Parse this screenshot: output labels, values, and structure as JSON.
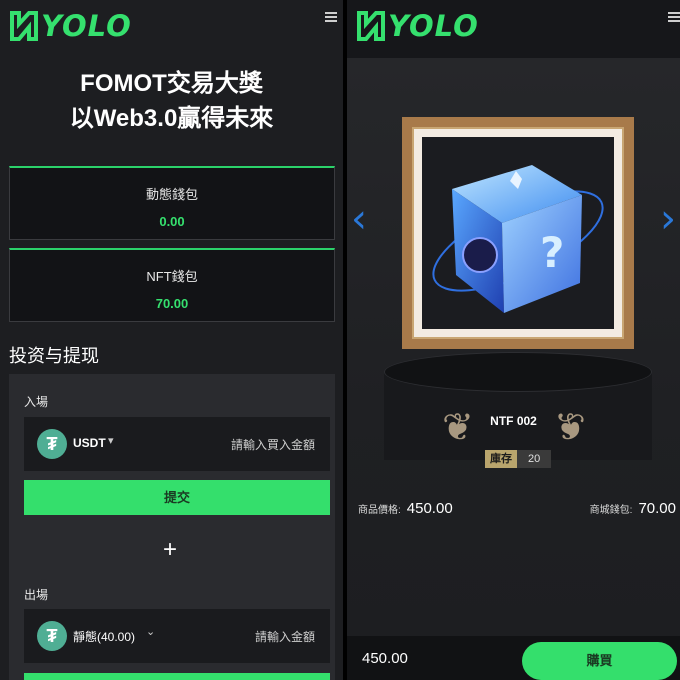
{
  "left": {
    "header": {
      "logo_text": "YOLO",
      "logo_icon": "yolo-logo-icon",
      "menu_icon": "hamburger-menu-icon"
    },
    "hero": {
      "line1": "FOMOT交易大獎",
      "line2": "以Web3.0贏得未來"
    },
    "wallets": [
      {
        "label": "動態錢包",
        "value": "0.00"
      },
      {
        "label": "NFT錢包",
        "value": "70.00"
      }
    ],
    "section_title": "投资与提现",
    "deposit": {
      "label": "入場",
      "token": "USDT",
      "token_icon": "tether-icon",
      "dropdown_caret": "▾",
      "placeholder": "請輸入買入金額",
      "submit_label": "提交"
    },
    "plus_icon": "+",
    "withdraw": {
      "label": "出場",
      "token": "靜態(40.00)",
      "token_icon": "tether-icon",
      "dropdown_caret": "⌄",
      "placeholder": "請輸入金額"
    }
  },
  "right": {
    "header": {
      "logo_text": "YOLO",
      "logo_icon": "yolo-logo-icon",
      "menu_icon": "hamburger-menu-icon"
    },
    "nav": {
      "prev_icon": "chevron-left-icon",
      "next_icon": "chevron-right-icon"
    },
    "item": {
      "name": "NTF 002",
      "stock_label": "庫存",
      "stock_value": "20"
    },
    "price": {
      "label": "商品價格:",
      "value": "450.00",
      "wallet_label": "商城錢包:",
      "wallet_value": "70.00"
    },
    "bottom": {
      "total": "450.00",
      "buy_label": "購買"
    }
  },
  "colors": {
    "accent": "#34df6c",
    "background": "#1d1e21",
    "card": "#2a2b2f",
    "arrow": "#2a78d8"
  }
}
